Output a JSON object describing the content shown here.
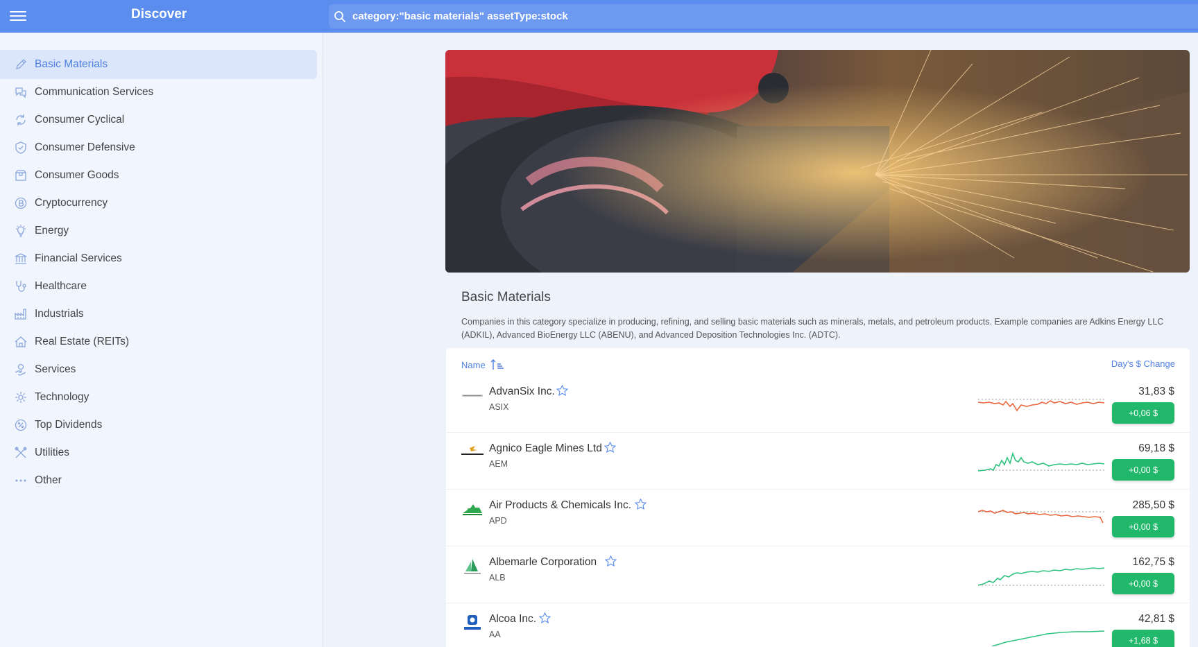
{
  "header": {
    "title": "Discover",
    "search_value": "category:\"basic materials\" assetType:stock"
  },
  "sidebar": {
    "items": [
      {
        "label": "Basic Materials",
        "icon": "pencil-icon",
        "active": true
      },
      {
        "label": "Communication Services",
        "icon": "chat-icon"
      },
      {
        "label": "Consumer Cyclical",
        "icon": "cycle-icon"
      },
      {
        "label": "Consumer Defensive",
        "icon": "shield-icon"
      },
      {
        "label": "Consumer Goods",
        "icon": "box-icon"
      },
      {
        "label": "Cryptocurrency",
        "icon": "bitcoin-icon"
      },
      {
        "label": "Energy",
        "icon": "lightbulb-icon"
      },
      {
        "label": "Financial Services",
        "icon": "bank-icon"
      },
      {
        "label": "Healthcare",
        "icon": "stethoscope-icon"
      },
      {
        "label": "Industrials",
        "icon": "factory-icon"
      },
      {
        "label": "Real Estate (REITs)",
        "icon": "house-icon"
      },
      {
        "label": "Services",
        "icon": "hand-icon"
      },
      {
        "label": "Technology",
        "icon": "gear-icon"
      },
      {
        "label": "Top Dividends",
        "icon": "percent-icon"
      },
      {
        "label": "Utilities",
        "icon": "tools-icon"
      },
      {
        "label": "Other",
        "icon": "dots-icon"
      }
    ]
  },
  "category": {
    "title": "Basic Materials",
    "description": "Companies in this category specialize in producing, refining, and selling basic materials such as minerals, metals, and petroleum products. Example companies are Adkins Energy LLC (ADKIL), Advanced BioEnergy LLC (ABENU), and Advanced Deposition Technologies Inc. (ADTC)."
  },
  "list": {
    "name_header": "Name",
    "change_header": "Day's $ Change",
    "rows": [
      {
        "name": "AdvanSix Inc.",
        "ticker": "ASIX",
        "price": "31,83 $",
        "change": "+0,06 $",
        "trend": "down",
        "logo": "advansix-logo"
      },
      {
        "name": "Agnico Eagle Mines Ltd",
        "ticker": "AEM",
        "price": "69,18 $",
        "change": "+0,00 $",
        "trend": "up",
        "logo": "agnico-logo"
      },
      {
        "name": "Air Products & Chemicals Inc.",
        "ticker": "APD",
        "price": "285,50 $",
        "change": "+0,00 $",
        "trend": "down",
        "logo": "airproducts-logo"
      },
      {
        "name": "Albemarle Corporation",
        "ticker": "ALB",
        "price": "162,75 $",
        "change": "+0,00 $",
        "trend": "up",
        "logo": "albemarle-logo"
      },
      {
        "name": "Alcoa Inc.",
        "ticker": "AA",
        "price": "42,81 $",
        "change": "+1,68 $",
        "trend": "up",
        "logo": "alcoa-logo"
      }
    ]
  },
  "colors": {
    "accent": "#5b8def",
    "positive": "#21b86b",
    "spark_up": "#2ec27e",
    "spark_down": "#e8663d"
  }
}
